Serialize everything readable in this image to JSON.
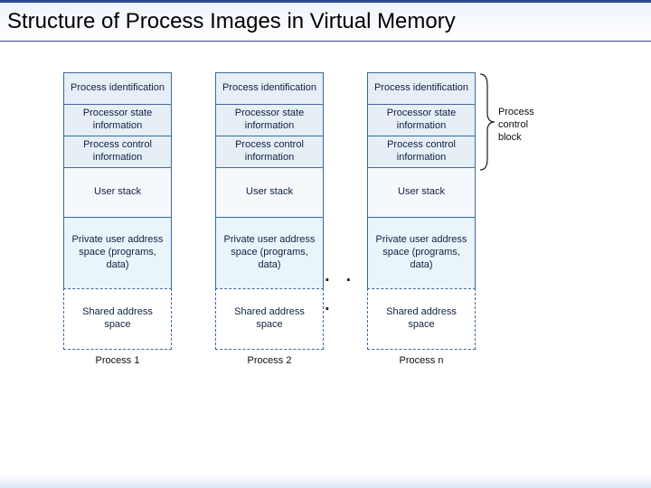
{
  "title": "Structure of Process Images in Virtual Memory",
  "columns": [
    {
      "caption": "Process 1"
    },
    {
      "caption": "Process 2"
    },
    {
      "caption": "Process n"
    }
  ],
  "rows": {
    "pid": "Process identification",
    "psi": "Processor state information",
    "pci": "Process control information",
    "us": "User stack",
    "pas": "Private user address space (programs, data)",
    "sas": "Shared address space"
  },
  "ellipsis": ". . .",
  "bracket_label_l1": "Process",
  "bracket_label_l2": "control",
  "bracket_label_l3": "block"
}
